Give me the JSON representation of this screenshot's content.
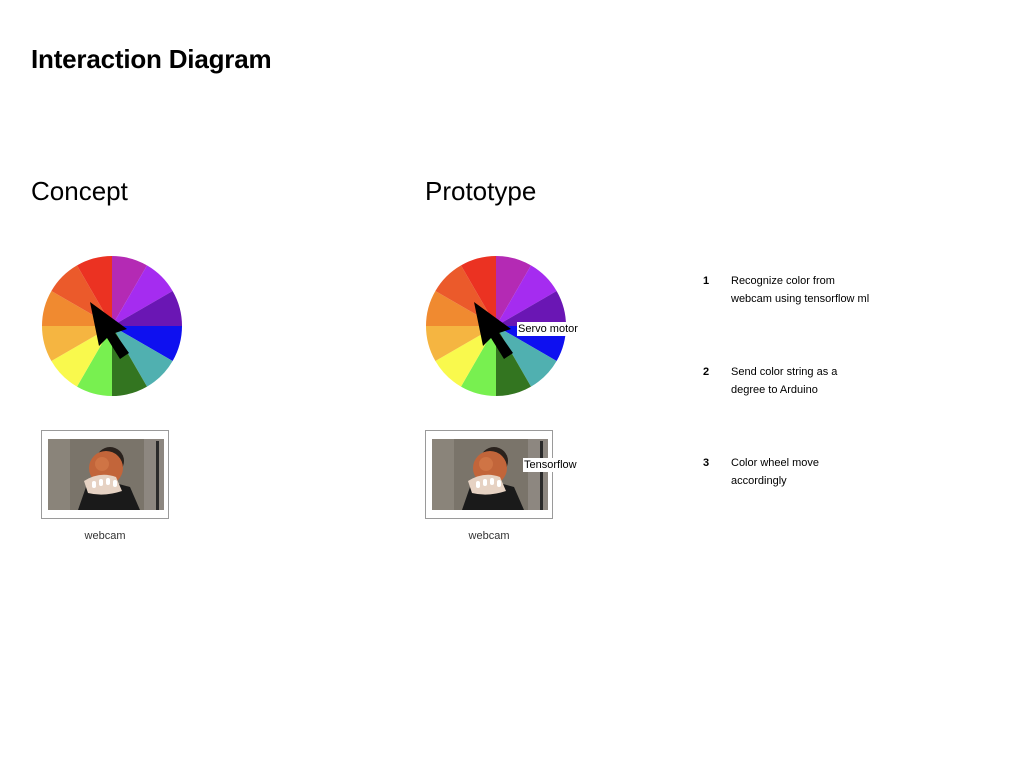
{
  "title": "Interaction Diagram",
  "concept": {
    "heading": "Concept",
    "webcam_caption": "webcam"
  },
  "prototype": {
    "heading": "Prototype",
    "webcam_caption": "webcam",
    "servo_label": "Servo motor",
    "tensorflow_label": "Tensorflow"
  },
  "steps": [
    {
      "number": "1",
      "lines": [
        "Recognize color from",
        "webcam using tensorflow ml"
      ]
    },
    {
      "number": "2",
      "lines": [
        "Send color string as a",
        "degree to Arduino"
      ]
    },
    {
      "number": "3",
      "lines": [
        "Color wheel move",
        "accordingly"
      ]
    }
  ],
  "wheel_colors": [
    "#b42ab4",
    "#a52cf0",
    "#6a16b4",
    "#0e10f0",
    "#50b0b0",
    "#337520",
    "#78f050",
    "#f9f94d",
    "#f5b541",
    "#f08a30",
    "#eb5a2b",
    "#eb3222"
  ],
  "arrow_color": "#000000"
}
